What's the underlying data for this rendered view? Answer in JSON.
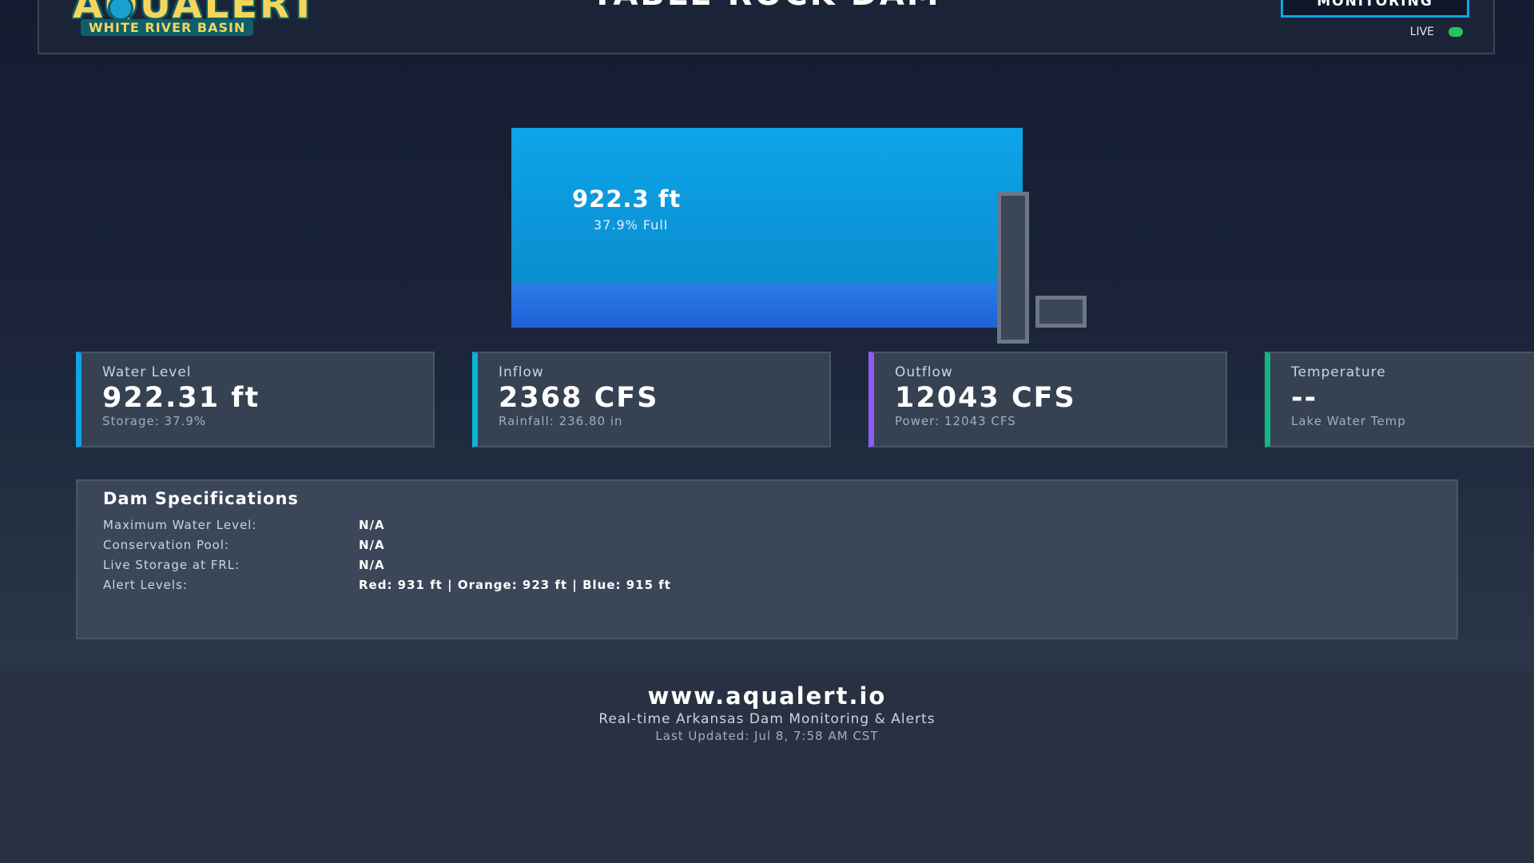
{
  "header": {
    "logo_text": "AQUALERT",
    "logo_subtitle": "WHITE RIVER BASIN",
    "title": "TABLE ROCK DAM",
    "monitoring_button": "MONITORING",
    "live_label": "LIVE"
  },
  "reservoir": {
    "level_text": "922.3 ft",
    "percent_text": "37.9% Full",
    "fill_fraction": 0.379
  },
  "stats": [
    {
      "label": "Water Level",
      "value": "922.31 ft",
      "sub": "Storage: 37.9%",
      "accent": "#0ea5e9"
    },
    {
      "label": "Inflow",
      "value": "2368 CFS",
      "sub": "Rainfall: 236.80 in",
      "accent": "#06b6d4"
    },
    {
      "label": "Outflow",
      "value": "12043 CFS",
      "sub": "Power: 12043 CFS",
      "accent": "#8b5cf6"
    },
    {
      "label": "Temperature",
      "value": "--",
      "sub": "Lake Water Temp",
      "accent": "#10b981"
    }
  ],
  "specs": {
    "title": "Dam Specifications",
    "rows": [
      {
        "key": "Maximum Water Level:",
        "value": "N/A"
      },
      {
        "key": "Conservation Pool:",
        "value": "N/A"
      },
      {
        "key": "Live Storage at FRL:",
        "value": "N/A"
      },
      {
        "key": "Alert Levels:",
        "value": "Red: 931 ft | Orange: 923 ft | Blue: 915 ft"
      }
    ]
  },
  "footer": {
    "url": "www.aqualert.io",
    "tagline": "Real-time Arkansas Dam Monitoring & Alerts",
    "updated": "Last Updated: Jul 8, 7:58 AM CST"
  },
  "colors": {
    "accent": "#0ea5e9",
    "live": "#22c55e",
    "logo_gold": "#f5d65a",
    "logo_teal": "#0d5f6a"
  }
}
